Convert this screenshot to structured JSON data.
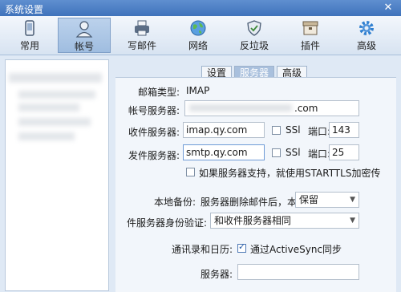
{
  "window": {
    "title": "系统设置",
    "close_glyph": "✕"
  },
  "toolbar": {
    "items": [
      {
        "label": "常用",
        "icon": "phone-icon"
      },
      {
        "label": "帐号",
        "icon": "user-icon",
        "active": true
      },
      {
        "label": "写邮件",
        "icon": "printer-icon"
      },
      {
        "label": "网络",
        "icon": "globe-icon"
      },
      {
        "label": "反垃圾",
        "icon": "shield-icon"
      },
      {
        "label": "插件",
        "icon": "box-icon"
      },
      {
        "label": "高级",
        "icon": "gear-icon"
      }
    ]
  },
  "tabs": [
    {
      "label": "设置"
    },
    {
      "label": "服务器",
      "active": true
    },
    {
      "label": "高级"
    }
  ],
  "form": {
    "mail_type_label": "邮箱类型:",
    "mail_type_value": "IMAP",
    "account_server_label": "帐号服务器:",
    "account_server_value": ".com",
    "incoming_label": "收件服务器:",
    "incoming_value": "imap.qy.com",
    "incoming_ssl_label": "SSl",
    "incoming_port_label": "端口:",
    "incoming_port_value": "143",
    "outgoing_label": "发件服务器:",
    "outgoing_value": "smtp.qy.com",
    "outgoing_ssl_label": "SSl",
    "outgoing_port_label": "端口:",
    "outgoing_port_value": "25",
    "starttls_label": "如果服务器支持，就使用STARTTLS加密传",
    "backup_label": "本地备份:",
    "backup_text": "服务器删除邮件后，本地",
    "backup_value": "保留",
    "auth_label": "件服务器身份验证:",
    "auth_value": "和收件服务器相同",
    "sync_label": "通讯录和日历:",
    "activesync_label": "通过ActiveSync同步",
    "server_label": "服务器:",
    "server_value": ""
  },
  "colors": {
    "accent": "#3f73bb",
    "active_tab": "#a9c0dd"
  }
}
